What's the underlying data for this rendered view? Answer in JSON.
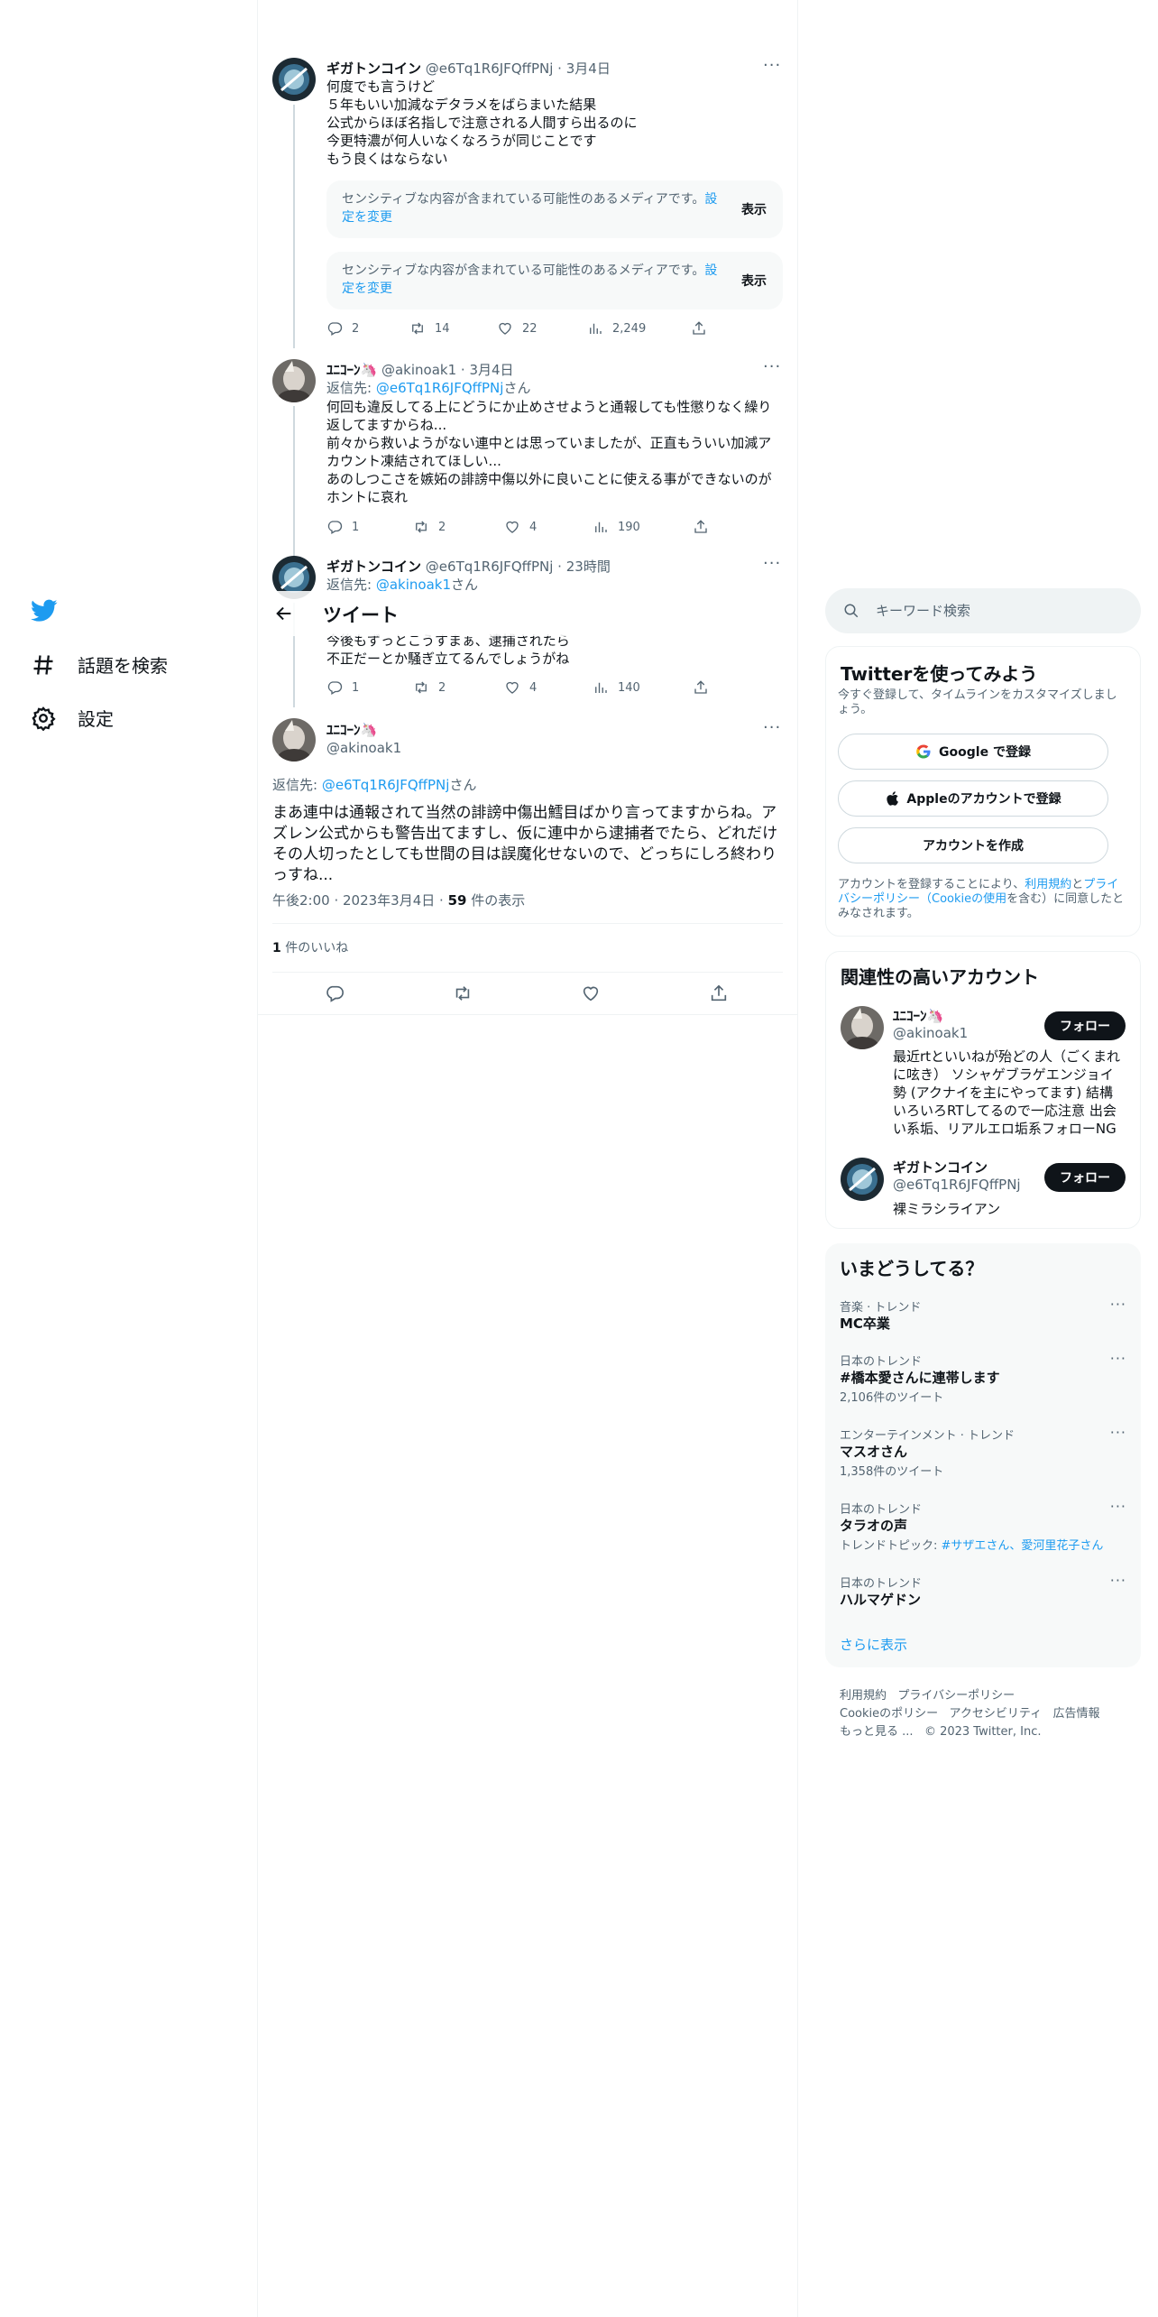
{
  "nav": {
    "items": [
      {
        "label": "話題を検索"
      },
      {
        "label": "設定"
      }
    ]
  },
  "header": {
    "title": "ツイート"
  },
  "thread": [
    {
      "name": "ギガトンコイン",
      "handle": "@e6Tq1R6JFQffPNj",
      "time": "3月4日",
      "lines": [
        "何度でも言うけど",
        "５年もいい加減なデタラメをばらまいた結果",
        "公式からほぼ名指しで注意される人間すら出るのに",
        "今更特濃が何人いなくなろうが同じことです",
        "もう良くはならない"
      ],
      "media": [
        {
          "text": "センシティブな内容が含まれている可能性のあるメディアです。",
          "link": "設定を変更",
          "show": "表示"
        },
        {
          "text": "センシティブな内容が含まれている可能性のあるメディアです。",
          "link": "設定を変更",
          "show": "表示"
        }
      ],
      "stats": {
        "reply": "2",
        "retweet": "14",
        "like": "22",
        "views": "2,249"
      }
    },
    {
      "name": "ﾕﾆｺｰﾝ🦄",
      "handle": "@akinoak1",
      "time": "3月4日",
      "reply_label": "返信先:",
      "reply_to": "@e6Tq1R6JFQffPNj",
      "reply_suffix": "さん",
      "lines": [
        "何回も違反してる上にどうにか止めさせようと通報しても性懲りなく繰り返してますからね...",
        "前々から救いようがない連中とは思っていましたが、正直もういい加減アカウント凍結されてほしい...",
        "あのしつこさを嫉妬の誹謗中傷以外に良いことに使える事ができないのがホントに哀れ"
      ],
      "stats": {
        "reply": "1",
        "retweet": "2",
        "like": "4",
        "views": "190"
      }
    },
    {
      "name": "ギガトンコイン",
      "handle": "@e6Tq1R6JFQffPNj",
      "time": "23時間",
      "reply_label": "返信先:",
      "reply_to": "@akinoak1",
      "reply_suffix": "さん",
      "lines": [
        "今後もずっとこうすまぁ、逮捕されたら",
        "不正だーとか騒ぎ立てるんでしょうがね"
      ],
      "stats": {
        "reply": "1",
        "retweet": "2",
        "like": "4",
        "views": "140"
      }
    }
  ],
  "main_tweet": {
    "name": "ﾕﾆｺｰﾝ🦄",
    "handle": "@akinoak1",
    "reply_label": "返信先:",
    "reply_to": "@e6Tq1R6JFQffPNj",
    "reply_suffix": "さん",
    "text": "まあ連中は通報されて当然の誹謗中傷出鱈目ばかり言ってますからね。アズレン公式からも警告出てますし、仮に連中から逮捕者でたら、どれだけその人切ったとしても世間の目は誤魔化せないので、どっちにしろ終わりっすね...",
    "time": "午後2:00 · 2023年3月4日 · ",
    "views_count": "59",
    "views_label": " 件の表示",
    "likes_count": "1",
    "likes_label": " 件のいいね"
  },
  "search": {
    "placeholder": "キーワード検索"
  },
  "signup": {
    "title": "Twitterを使ってみよう",
    "subtitle": "今すぐ登録して、タイムラインをカスタマイズしましょう。",
    "google": "Google で登録",
    "apple": "Appleのアカウントで登録",
    "create": "アカウントを作成",
    "terms_prefix": "アカウントを登録することにより、",
    "terms_link": "利用規約",
    "terms_and": "と",
    "privacy_link": "プライバシーポリシー",
    "cookie_link": "（Cookieの使用",
    "terms_suffix": "を含む）に同意したとみなされます。"
  },
  "related": {
    "title": "関連性の高いアカウント",
    "accounts": [
      {
        "name": "ﾕﾆｺｰﾝ🦄",
        "handle": "@akinoak1",
        "bio": "最近rtといいねが殆どの人（ごくまれに呟き） ソシャゲブラゲエンジョイ勢 (アクナイを主にやってます) 結構いろいろRTしてるので一応注意 出会い系垢、リアルエロ垢系フォローNG",
        "follow": "フォロー"
      },
      {
        "name": "ギガトンコイン",
        "handle": "@e6Tq1R6JFQffPNj",
        "bio": "裸ミラシライアン",
        "follow": "フォロー"
      }
    ]
  },
  "trends": {
    "title": "いまどうしてる？",
    "items": [
      {
        "category": "音楽 · トレンド",
        "name": "MC卒業",
        "count": ""
      },
      {
        "category": "日本のトレンド",
        "name": "#橋本愛さんに連帯します",
        "count": "2,106件のツイート"
      },
      {
        "category": "エンターテインメント · トレンド",
        "name": "マスオさん",
        "count": "1,358件のツイート"
      },
      {
        "category": "日本のトレンド",
        "name": "タラオの声",
        "count_prefix": "トレンドトピック: ",
        "count_link": "#サザエさん、愛河里花子さん"
      },
      {
        "category": "日本のトレンド",
        "name": "ハルマゲドン",
        "count": ""
      }
    ],
    "more": "さらに表示"
  },
  "footer": {
    "line1": [
      "利用規約",
      "プライバシーポリシー"
    ],
    "line2": [
      "Cookieのポリシー",
      "アクセシビリティ",
      "広告情報"
    ],
    "more": "もっと見る ...",
    "copyright": "© 2023 Twitter, Inc."
  },
  "colors": {
    "accent": "#1d9bf0",
    "text": "#0f1419",
    "secondary": "#536471",
    "border": "#eff3f4"
  }
}
